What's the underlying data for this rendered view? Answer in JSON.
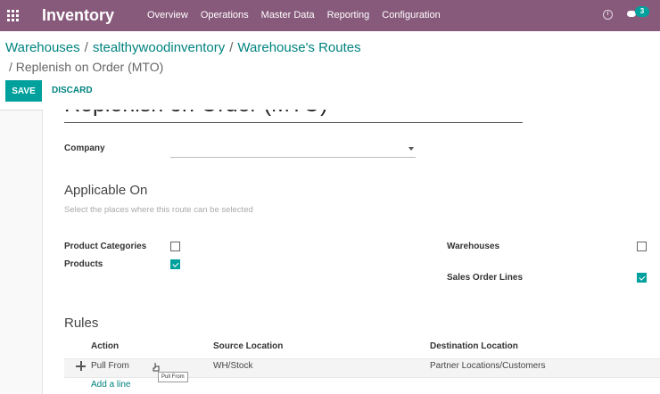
{
  "topbar": {
    "brand": "Inventory",
    "menu": [
      "Overview",
      "Operations",
      "Master Data",
      "Reporting",
      "Configuration"
    ],
    "chat_badge": "3",
    "color": "#875a7b"
  },
  "breadcrumb": {
    "items": [
      "Warehouses",
      "stealthywoodinventory",
      "Warehouse's Routes"
    ],
    "current": "Replenish on Order (MTO)"
  },
  "buttons": {
    "save": "SAVE",
    "discard": "DISCARD"
  },
  "form": {
    "title": "Replenish on Order (MTO)",
    "company_label": "Company",
    "company_value": "",
    "applicable_heading": "Applicable On",
    "applicable_hint": "Select the places where this route can be selected",
    "product_categories_label": "Product Categories",
    "products_label": "Products",
    "warehouses_label": "Warehouses",
    "sales_order_lines_label": "Sales Order Lines",
    "checks": {
      "product_categories": false,
      "products": true,
      "warehouses": false,
      "sales_order_lines": true
    }
  },
  "rules": {
    "heading": "Rules",
    "columns": [
      "Action",
      "Source Location",
      "Destination Location"
    ],
    "rows": [
      {
        "action": "Pull From",
        "source": "WH/Stock",
        "destination": "Partner Locations/Customers"
      }
    ],
    "add_line": "Add a line",
    "tooltip": "Pull From"
  },
  "accent": "#00a09d"
}
